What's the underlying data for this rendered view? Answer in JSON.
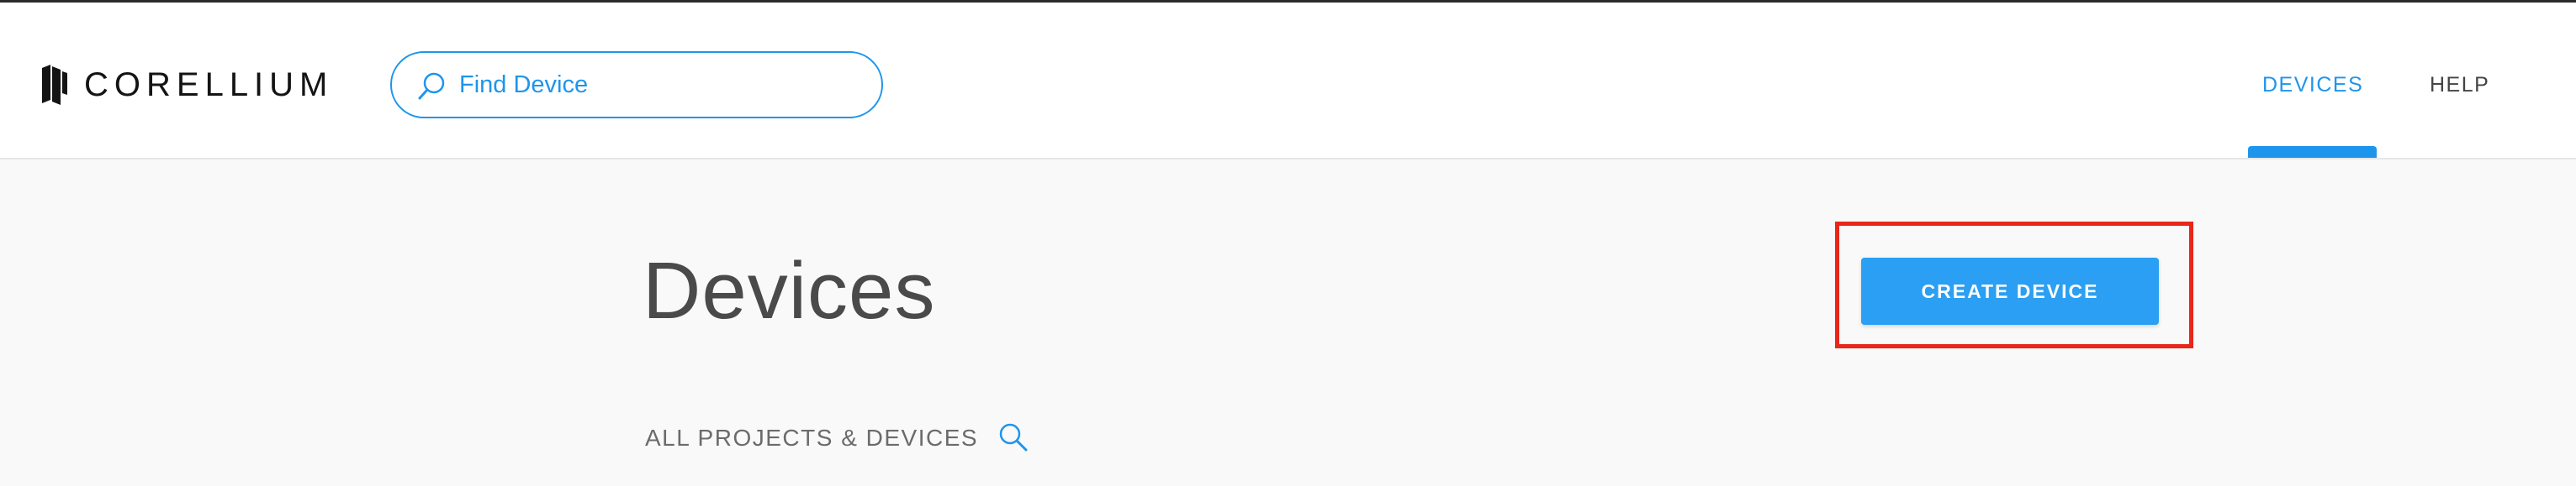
{
  "header": {
    "brand": "CORELLIUM",
    "search": {
      "placeholder": "Find Device",
      "value": ""
    },
    "nav": [
      {
        "label": "DEVICES",
        "active": true
      },
      {
        "label": "HELP",
        "active": false
      }
    ]
  },
  "main": {
    "title": "Devices",
    "create_button": "CREATE DEVICE",
    "section_heading": "ALL PROJECTS & DEVICES"
  },
  "icons": {
    "logo": "corellium-logo-icon",
    "search": "search-icon",
    "section_search": "search-icon"
  },
  "colors": {
    "accent": "#1e95ec",
    "button": "#2a9ff3",
    "highlight": "#e8261a",
    "background": "#f9f9f9",
    "header": "#ffffff"
  }
}
